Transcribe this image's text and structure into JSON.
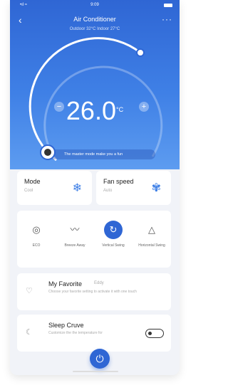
{
  "status": {
    "time": "9:09",
    "signal": "•ıl ≈"
  },
  "header": {
    "back_icon": "‹",
    "title": "Air Conditioner",
    "subtitle": "Outdoor 32°C Indoor 27°C",
    "more_icon": "···"
  },
  "thermostat": {
    "temperature": "26.0",
    "unit": "°C",
    "minus": "−",
    "plus": "+",
    "hint": "The master mode make you a fun"
  },
  "cards": [
    {
      "label": "Mode",
      "value": "Cool",
      "icon": "❄"
    },
    {
      "label": "Fan speed",
      "value": "Auto",
      "icon": "✾"
    }
  ],
  "modes": [
    {
      "caption": "ECO",
      "icon": "◎"
    },
    {
      "caption": "Breeze Away",
      "icon": "〰"
    },
    {
      "caption": "Vertical Swing",
      "icon": "↻"
    },
    {
      "caption": "Horizontal Swing",
      "icon": "△"
    }
  ],
  "rows": [
    {
      "name": "My Favorite",
      "tag": "Eddy",
      "desc": "Choose your favorite setting to activate it with one touch",
      "icon": "♡"
    },
    {
      "name": "Sleep Cruve",
      "tag": "",
      "desc": "Customize the the temperature for",
      "icon": "☾"
    }
  ],
  "power_icon": "⏻",
  "colors": {
    "accent": "#2f66d4",
    "hero_top": "#2f66d4",
    "hero_bottom": "#5d9cf0"
  }
}
